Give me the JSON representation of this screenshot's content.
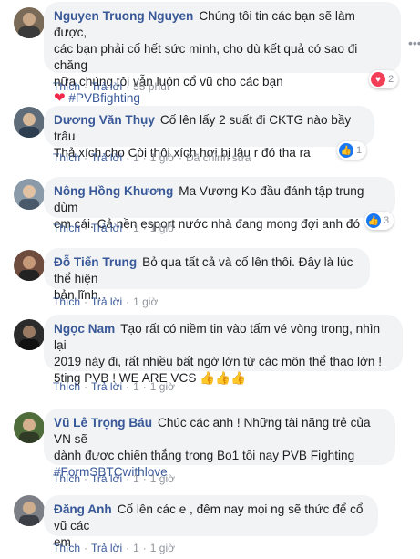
{
  "comments": [
    {
      "author": "Nguyen Truong Nguyen",
      "text_lines": [
        "Chúng tôi tin các bạn sẽ làm được,",
        "các bạn phải cố hết sức mình, cho dù kết quả có sao đi chăng",
        "nữa chúng tôi vẫn luôn cổ vũ cho các bạn"
      ],
      "hashtag": "#PVBfighting",
      "like_label": "Thích",
      "reply_label": "Trả lời",
      "time": "55 phút",
      "reaction_count": "2",
      "reaction": "love"
    },
    {
      "author": "Dương Văn Thụy",
      "text_lines": [
        "Cố lên lấy 2 suất đi CKTG nào bầy trâu",
        "Thả xích cho Còi thôi xích hơi bị lâu r đó tha ra"
      ],
      "like_label": "Thích",
      "reply_label": "Trả lời",
      "count": "1",
      "time": "1 giờ",
      "edited_label": "Đã chỉnh sửa",
      "reaction_count": "1",
      "reaction": "like"
    },
    {
      "author": "Nông Hồng Khương",
      "text_lines": [
        "Ma Vương Ko đầu đánh tập trung dùm",
        "em cái. Cả nền esport nước nhà đang mong đợi anh đó"
      ],
      "like_label": "Thích",
      "reply_label": "Trả lời",
      "count": "1",
      "time": "1 giờ",
      "reaction_count": "3",
      "reaction": "like"
    },
    {
      "author": "Đỗ Tiến Trung",
      "text_lines": [
        "Bỏ qua tất cả và cố lên thôi. Đây là lúc thể hiện",
        "bản lĩnh."
      ],
      "like_label": "Thích",
      "reply_label": "Trả lời",
      "time": "1 giờ"
    },
    {
      "author": "Ngọc Nam",
      "text_lines": [
        "Tạo rất có niềm tin vào tấm vé vòng trong, nhìn lại",
        "2019 này đi, rất nhiều bất ngờ lớn từ các môn thể thao lớn !",
        "5ting PVB ! WE ARE VCS 👍👍👍"
      ],
      "like_label": "Thích",
      "reply_label": "Trả lời",
      "count": "1",
      "time": "1 giờ"
    },
    {
      "author": "Vũ Lê Trọng Báu",
      "text_lines": [
        "Chúc các anh ! Những tài năng trẻ của VN sẽ",
        "dành được chiến thắng trong Bo1 tối nay PVB Fighting"
      ],
      "hashtag": "#FormSBTCwithlove",
      "like_label": "Thích",
      "reply_label": "Trả lời",
      "count": "1",
      "time": "1 giờ"
    },
    {
      "author": "Đăng Anh",
      "text_lines": [
        "Cố lên các e , đêm nay mọi ng sẽ thức để cổ vũ các",
        "em"
      ],
      "like_label": "Thích",
      "reply_label": "Trả lời",
      "count": "1",
      "time": "1 giờ"
    }
  ],
  "icons": {
    "more": "more-options-icon",
    "like": "like-reaction-icon",
    "love": "love-reaction-icon",
    "heart": "heart-emoji-icon"
  },
  "colors": {
    "author": "#385898",
    "bubble": "#f2f3f5",
    "meta": "#90949c",
    "like": "#1877f2",
    "love": "#f33e58"
  }
}
